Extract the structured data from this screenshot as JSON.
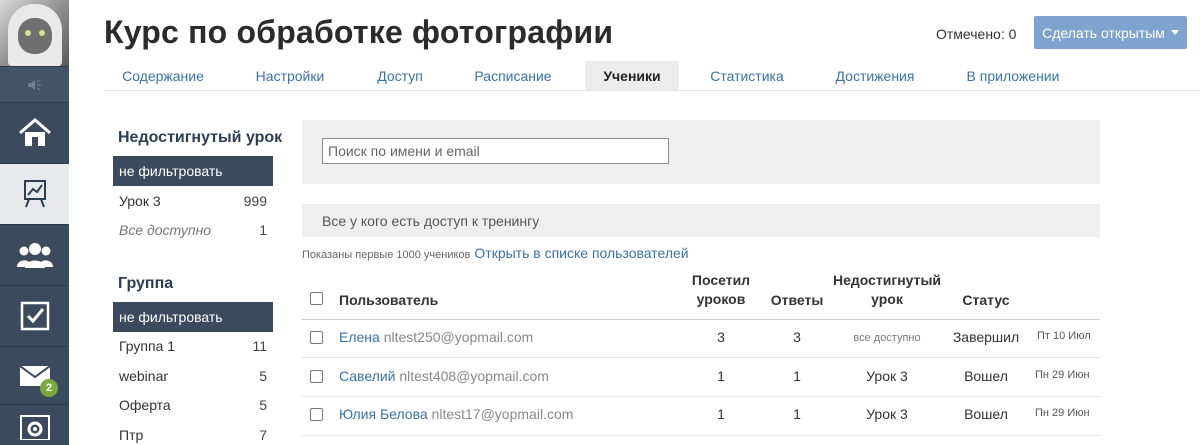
{
  "header": {
    "title": "Курс по обработке фотографии",
    "marked_label": "Отмечено: 0",
    "open_button": "Сделать открытым"
  },
  "tabs": [
    {
      "label": "Содержание"
    },
    {
      "label": "Настройки"
    },
    {
      "label": "Доступ"
    },
    {
      "label": "Расписание"
    },
    {
      "label": "Ученики",
      "active": true
    },
    {
      "label": "Статистика"
    },
    {
      "label": "Достижения"
    },
    {
      "label": "В приложении"
    }
  ],
  "sidebar": {
    "icons": [
      "speaker-icon",
      "home-icon",
      "chart-icon",
      "users-icon",
      "tasks-icon",
      "mail-icon",
      "settings-icon"
    ],
    "mail_badge": "2"
  },
  "filters": {
    "lesson": {
      "title": "Недостигнутый урок",
      "items": [
        {
          "label": "не фильтровать",
          "count": ""
        },
        {
          "label": "Урок 3",
          "count": "999"
        },
        {
          "label": "Все доступно",
          "count": "1"
        }
      ]
    },
    "group": {
      "title": "Группа",
      "items": [
        {
          "label": "не фильтровать",
          "count": ""
        },
        {
          "label": "Группа 1",
          "count": "11"
        },
        {
          "label": "webinar",
          "count": "5"
        },
        {
          "label": "Оферта",
          "count": "5"
        },
        {
          "label": "Птр",
          "count": "7"
        }
      ]
    }
  },
  "search": {
    "placeholder": "Поиск по имени и email"
  },
  "access_label": "Все у кого есть доступ к тренингу",
  "shown_text": "Показаны первые 1000 учеников",
  "open_in_list_link": "Открыть в списке пользователей",
  "table": {
    "headers": {
      "user": "Пользователь",
      "visited_1": "Посетил",
      "visited_2": "уроков",
      "answers": "Ответы",
      "lesson_1": "Недостигнутый",
      "lesson_2": "урок",
      "status": "Статус"
    },
    "rows": [
      {
        "name": "Елена",
        "email": "nltest250@yopmail.com",
        "visited": "3",
        "answers": "3",
        "lesson": "все доступно",
        "status": "Завершил",
        "date": "Пт 10 Июл"
      },
      {
        "name": "Савелий",
        "email": "nltest408@yopmail.com",
        "visited": "1",
        "answers": "1",
        "lesson": "Урок 3",
        "status": "Вошел",
        "date": "Пн 29 Июн"
      },
      {
        "name": "Юлия Белова",
        "email": "nltest17@yopmail.com",
        "visited": "1",
        "answers": "1",
        "lesson": "Урок 3",
        "status": "Вошел",
        "date": "Пн 29 Июн"
      }
    ]
  },
  "colors": {
    "sidebar": "#3c4a5e",
    "link": "#3a72a9",
    "button": "#7fa3cf",
    "badge": "#7aa83a"
  }
}
